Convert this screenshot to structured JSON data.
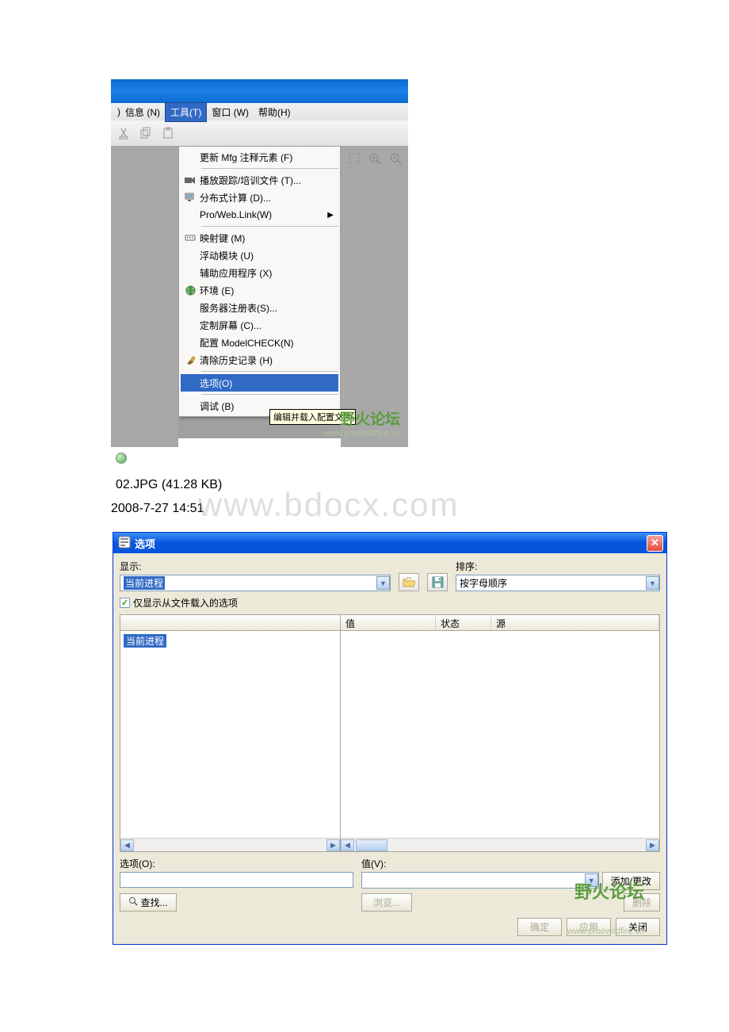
{
  "screenshot1": {
    "menubar": {
      "partial_left": ")",
      "info": "信息 (N)",
      "tools": "工具(T)",
      "window": "窗口 (W)",
      "help": "帮助(H)"
    },
    "dropdown": [
      {
        "label": "更新 Mfg 注释元素 (F)",
        "icon": ""
      },
      {
        "sep": true
      },
      {
        "label": "播放跟踪/培训文件 (T)...",
        "icon": "📹"
      },
      {
        "label": "分布式计算 (D)...",
        "icon": "🖥"
      },
      {
        "label": "Pro/Web.Link(W)",
        "icon": "",
        "submenu": true
      },
      {
        "sep": true
      },
      {
        "label": "映射键 (M)",
        "icon": "⌨"
      },
      {
        "label": "浮动模块 (U)",
        "icon": ""
      },
      {
        "label": "辅助应用程序 (X)",
        "icon": ""
      },
      {
        "label": "环境 (E)",
        "icon": "🌐"
      },
      {
        "label": "服务器注册表(S)...",
        "icon": ""
      },
      {
        "label": "定制屏幕 (C)...",
        "icon": ""
      },
      {
        "label": "配置 ModelCHECK(N)",
        "icon": ""
      },
      {
        "label": "清除历史记录 (H)",
        "icon": "🧹"
      },
      {
        "sep": true
      },
      {
        "label": "选项(O)",
        "icon": "",
        "selected": true
      },
      {
        "sep": true
      },
      {
        "label": "调试 (B)",
        "icon": ""
      }
    ],
    "tooltip": "编辑并载入配置文件",
    "watermark": "野火论坛",
    "watermark_sub": "www.proewildfire.cn"
  },
  "file_info": {
    "name": "02.JPG",
    "size": "(41.28 KB)",
    "timestamp": "2008-7-27 14:51"
  },
  "watermark_bdocx": "www.bdocx.com",
  "dialog": {
    "title": "选项",
    "show_label": "显示:",
    "show_value": "当前进程",
    "sort_label": "排序:",
    "sort_value": "按字母顺序",
    "checkbox_label": "仅显示从文件载入的选项",
    "tree_node": "当前进程",
    "col_value": "值",
    "col_status": "状态",
    "col_source": "源",
    "option_label": "选项(O):",
    "value_label": "值(V):",
    "add_change_btn": "添加/更改",
    "find_btn": "查找...",
    "browse_btn": "浏览...",
    "delete_btn": "删除",
    "ok_btn": "确定",
    "apply_btn": "应用",
    "close_btn": "关闭",
    "watermark": "野火论坛",
    "watermark_sub": "www.proewildfire.cn"
  }
}
